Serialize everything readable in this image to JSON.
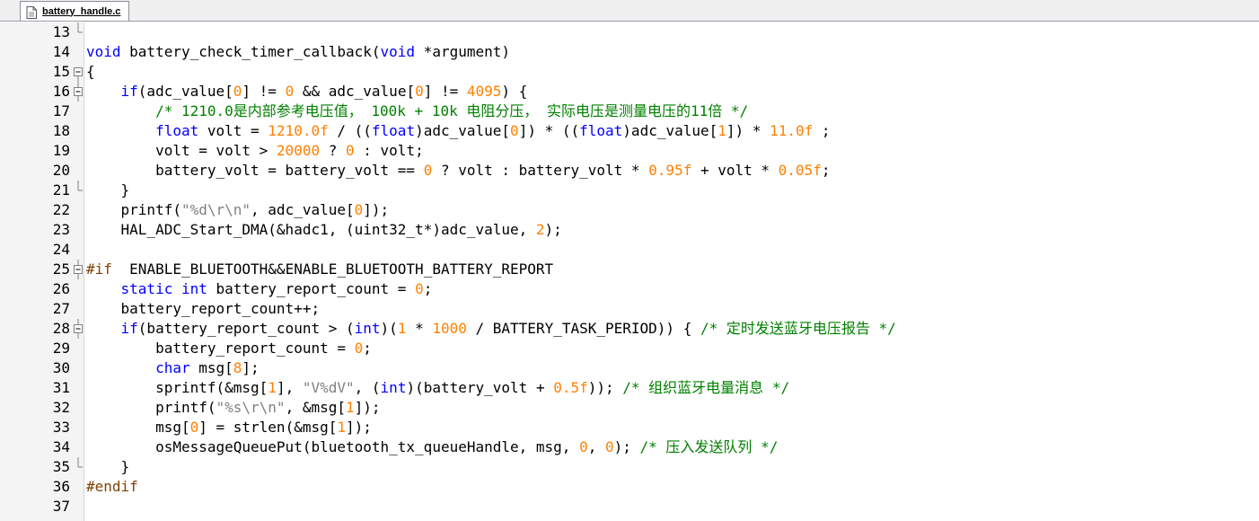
{
  "tab": {
    "filename": "battery_handle.c"
  },
  "editor": {
    "lines": [
      {
        "n": "13",
        "fold": "end",
        "tokens": []
      },
      {
        "n": "14",
        "fold": "",
        "tokens": [
          [
            "kw",
            "void"
          ],
          [
            "t",
            " battery_check_timer_callback("
          ],
          [
            "kw",
            "void"
          ],
          [
            "t",
            " *argument)"
          ]
        ]
      },
      {
        "n": "15",
        "fold": "box",
        "tokens": [
          [
            "t",
            "{"
          ]
        ]
      },
      {
        "n": "16",
        "fold": "box",
        "tokens": [
          [
            "t",
            "    "
          ],
          [
            "kw",
            "if"
          ],
          [
            "t",
            "(adc_value["
          ],
          [
            "num",
            "0"
          ],
          [
            "t",
            "] != "
          ],
          [
            "num",
            "0"
          ],
          [
            "t",
            " && adc_value["
          ],
          [
            "num",
            "0"
          ],
          [
            "t",
            "] != "
          ],
          [
            "num",
            "4095"
          ],
          [
            "t",
            ") {"
          ]
        ]
      },
      {
        "n": "17",
        "fold": "bar",
        "tokens": [
          [
            "t",
            "        "
          ],
          [
            "cm",
            "/* 1210.0是内部参考电压值， 100k + 10k 电阻分压， 实际电压是测量电压的11倍 */"
          ]
        ]
      },
      {
        "n": "18",
        "fold": "bar",
        "tokens": [
          [
            "t",
            "        "
          ],
          [
            "kw",
            "float"
          ],
          [
            "t",
            " volt = "
          ],
          [
            "num",
            "1210.0f"
          ],
          [
            "t",
            " / (("
          ],
          [
            "kw",
            "float"
          ],
          [
            "t",
            ")adc_value["
          ],
          [
            "num",
            "0"
          ],
          [
            "t",
            "]) * (("
          ],
          [
            "kw",
            "float"
          ],
          [
            "t",
            ")adc_value["
          ],
          [
            "num",
            "1"
          ],
          [
            "t",
            "]) * "
          ],
          [
            "num",
            "11.0f"
          ],
          [
            "t",
            " ;"
          ]
        ]
      },
      {
        "n": "19",
        "fold": "bar",
        "tokens": [
          [
            "t",
            "        volt = volt > "
          ],
          [
            "num",
            "20000"
          ],
          [
            "t",
            " ? "
          ],
          [
            "num",
            "0"
          ],
          [
            "t",
            " : volt;"
          ]
        ]
      },
      {
        "n": "20",
        "fold": "bar",
        "tokens": [
          [
            "t",
            "        battery_volt = battery_volt == "
          ],
          [
            "num",
            "0"
          ],
          [
            "t",
            " ? volt : battery_volt * "
          ],
          [
            "num",
            "0.95f"
          ],
          [
            "t",
            " + volt * "
          ],
          [
            "num",
            "0.05f"
          ],
          [
            "t",
            ";"
          ]
        ]
      },
      {
        "n": "21",
        "fold": "end",
        "tokens": [
          [
            "t",
            "    }"
          ]
        ]
      },
      {
        "n": "22",
        "fold": "bar",
        "tokens": [
          [
            "t",
            "    printf("
          ],
          [
            "str",
            "\"%d\\r\\n\""
          ],
          [
            "t",
            ", adc_value["
          ],
          [
            "num",
            "0"
          ],
          [
            "t",
            "]);"
          ]
        ]
      },
      {
        "n": "23",
        "fold": "bar",
        "tokens": [
          [
            "t",
            "    HAL_ADC_Start_DMA(&hadc1, (uint32_t*)adc_value, "
          ],
          [
            "num",
            "2"
          ],
          [
            "t",
            ");"
          ]
        ]
      },
      {
        "n": "24",
        "fold": "bar",
        "tokens": []
      },
      {
        "n": "25",
        "fold": "box",
        "tokens": [
          [
            "pp",
            "#if"
          ],
          [
            "t",
            "  ENABLE_BLUETOOTH&&ENABLE_BLUETOOTH_BATTERY_REPORT"
          ]
        ]
      },
      {
        "n": "26",
        "fold": "bar",
        "tokens": [
          [
            "t",
            "    "
          ],
          [
            "kw",
            "static"
          ],
          [
            "t",
            " "
          ],
          [
            "kw",
            "int"
          ],
          [
            "t",
            " battery_report_count = "
          ],
          [
            "num",
            "0"
          ],
          [
            "t",
            ";"
          ]
        ]
      },
      {
        "n": "27",
        "fold": "bar",
        "tokens": [
          [
            "t",
            "    battery_report_count++;"
          ]
        ]
      },
      {
        "n": "28",
        "fold": "box",
        "tokens": [
          [
            "t",
            "    "
          ],
          [
            "kw",
            "if"
          ],
          [
            "t",
            "(battery_report_count > ("
          ],
          [
            "kw",
            "int"
          ],
          [
            "t",
            ")("
          ],
          [
            "num",
            "1"
          ],
          [
            "t",
            " * "
          ],
          [
            "num",
            "1000"
          ],
          [
            "t",
            " / BATTERY_TASK_PERIOD)) { "
          ],
          [
            "cm",
            "/* 定时发送蓝牙电压报告 */"
          ]
        ]
      },
      {
        "n": "29",
        "fold": "bar",
        "tokens": [
          [
            "t",
            "        battery_report_count = "
          ],
          [
            "num",
            "0"
          ],
          [
            "t",
            ";"
          ]
        ]
      },
      {
        "n": "30",
        "fold": "bar",
        "tokens": [
          [
            "t",
            "        "
          ],
          [
            "kw",
            "char"
          ],
          [
            "t",
            " msg["
          ],
          [
            "num",
            "8"
          ],
          [
            "t",
            "];"
          ]
        ]
      },
      {
        "n": "31",
        "fold": "bar",
        "tokens": [
          [
            "t",
            "        sprintf(&msg["
          ],
          [
            "num",
            "1"
          ],
          [
            "t",
            "], "
          ],
          [
            "str",
            "\"V%dV\""
          ],
          [
            "t",
            ", ("
          ],
          [
            "kw",
            "int"
          ],
          [
            "t",
            ")(battery_volt + "
          ],
          [
            "num",
            "0.5f"
          ],
          [
            "t",
            ")); "
          ],
          [
            "cm",
            "/* 组织蓝牙电量消息 */"
          ]
        ]
      },
      {
        "n": "32",
        "fold": "bar",
        "tokens": [
          [
            "t",
            "        printf("
          ],
          [
            "str",
            "\"%s\\r\\n\""
          ],
          [
            "t",
            ", &msg["
          ],
          [
            "num",
            "1"
          ],
          [
            "t",
            "]);"
          ]
        ]
      },
      {
        "n": "33",
        "fold": "bar",
        "tokens": [
          [
            "t",
            "        msg["
          ],
          [
            "num",
            "0"
          ],
          [
            "t",
            "] = strlen(&msg["
          ],
          [
            "num",
            "1"
          ],
          [
            "t",
            "]);"
          ]
        ]
      },
      {
        "n": "34",
        "fold": "bar",
        "tokens": [
          [
            "t",
            "        osMessageQueuePut(bluetooth_tx_queueHandle, msg, "
          ],
          [
            "num",
            "0"
          ],
          [
            "t",
            ", "
          ],
          [
            "num",
            "0"
          ],
          [
            "t",
            "); "
          ],
          [
            "cm",
            "/* 压入发送队列 */"
          ]
        ]
      },
      {
        "n": "35",
        "fold": "end",
        "tokens": [
          [
            "t",
            "    }"
          ]
        ]
      },
      {
        "n": "36",
        "fold": "bar",
        "tokens": [
          [
            "pp",
            "#endif"
          ]
        ]
      },
      {
        "n": "37",
        "fold": "bar",
        "tokens": []
      }
    ]
  }
}
